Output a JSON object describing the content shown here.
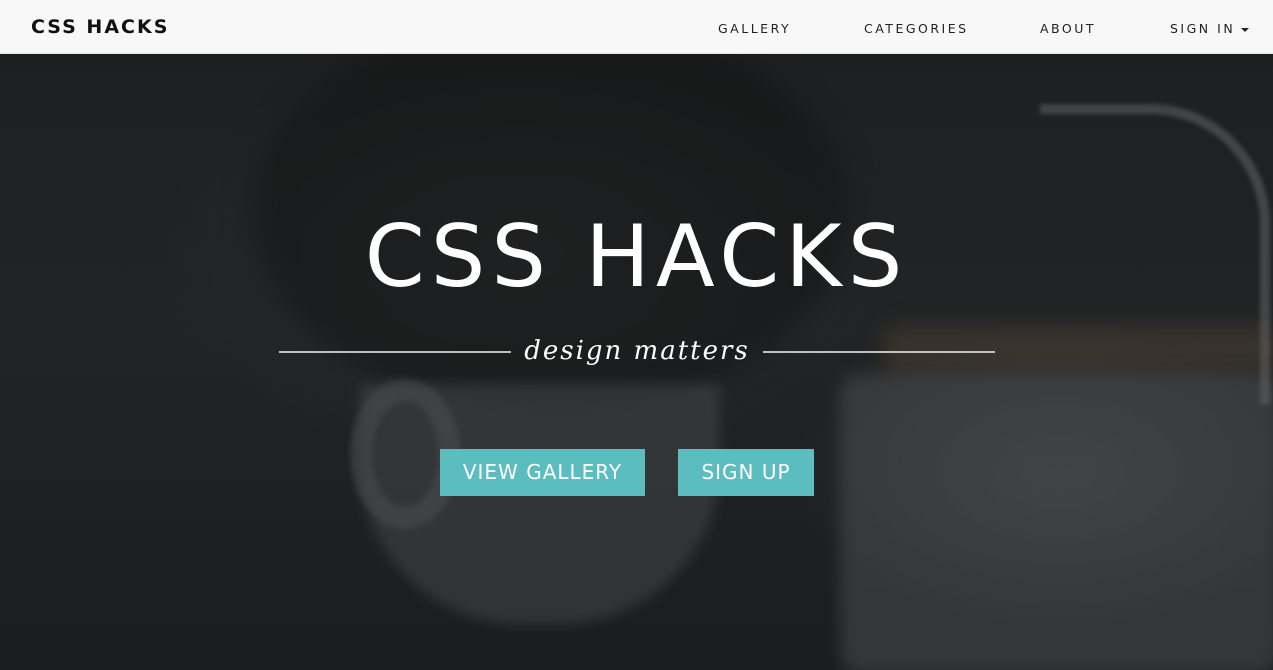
{
  "navbar": {
    "brand": "CSS HACKS",
    "items": [
      {
        "label": "GALLERY"
      },
      {
        "label": "CATEGORIES"
      },
      {
        "label": "ABOUT"
      },
      {
        "label": "SIGN IN",
        "dropdown": true
      }
    ]
  },
  "hero": {
    "title": "CSS HACKS",
    "tagline": "design matters",
    "buttons": {
      "view_gallery": "VIEW GALLERY",
      "sign_up": "SIGN UP"
    }
  },
  "colors": {
    "navbar_bg": "#f8f8f8",
    "accent": "#5bbdbf",
    "hero_text": "#ffffff"
  },
  "icons": {
    "sign_in_caret": "caret-down-icon"
  }
}
